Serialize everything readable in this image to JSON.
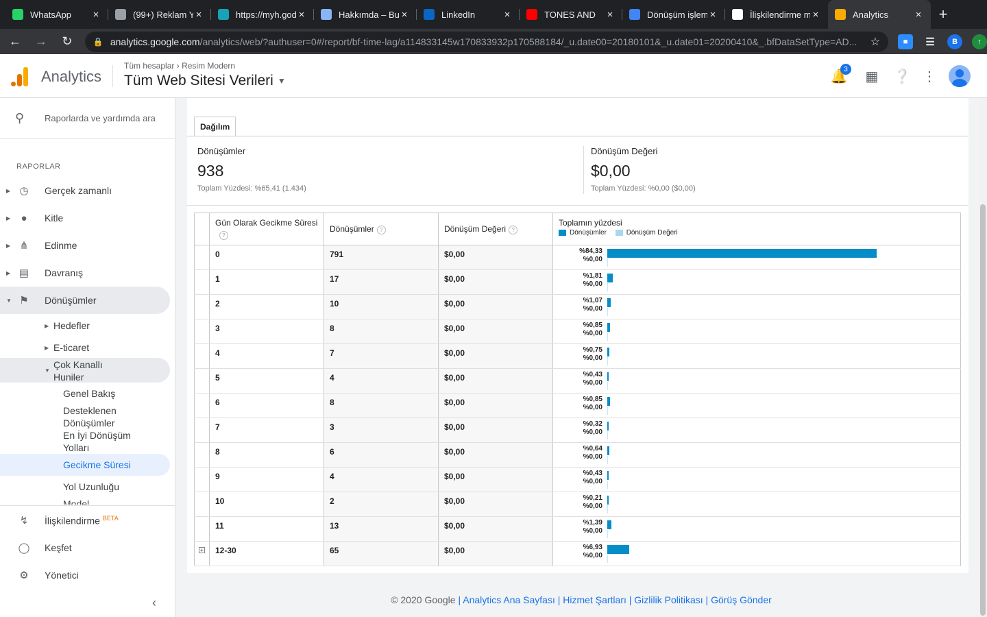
{
  "browser": {
    "tabs": [
      {
        "title": "WhatsApp",
        "favicon": "whatsapp-icon",
        "color": "#25d366"
      },
      {
        "title": "(99+) Reklam Y",
        "favicon": "image-icon",
        "color": "#9aa0a6"
      },
      {
        "title": "https://myh.god",
        "favicon": "swirl-icon",
        "color": "#17a2b8"
      },
      {
        "title": "Hakkımda – Bur",
        "favicon": "page-icon",
        "color": "#8ab4f8"
      },
      {
        "title": "LinkedIn",
        "favicon": "linkedin-icon",
        "color": "#0a66c2"
      },
      {
        "title": "TONES AND",
        "favicon": "youtube-icon",
        "color": "#ff0000"
      },
      {
        "title": "Dönüşüm işlem",
        "favicon": "google-ads-icon",
        "color": "#4285f4"
      },
      {
        "title": "İlişkilendirme m",
        "favicon": "google-icon",
        "color": "#ffffff"
      },
      {
        "title": "Analytics",
        "favicon": "analytics-icon",
        "color": "#f9ab00"
      }
    ],
    "url_host": "analytics.google.com",
    "url_path": "/analytics/web/?authuser=0#/report/bf-time-lag/a114833145w170833932p170588184/_u.date00=20180101&_u.date01=20200410&_.bfDataSetType=AD...",
    "profile_initial": "B"
  },
  "header": {
    "app_name": "Analytics",
    "breadcrumb_all": "Tüm hesaplar",
    "breadcrumb_account": "Resim Modern",
    "property": "Tüm Web Sitesi Verileri",
    "notification_count": "3"
  },
  "sidebar": {
    "search_placeholder": "Raporlarda ve yardımda ara",
    "section_title": "RAPORLAR",
    "items": [
      {
        "label": "Gerçek zamanlı",
        "icon": "clock-icon"
      },
      {
        "label": "Kitle",
        "icon": "person-icon"
      },
      {
        "label": "Edinme",
        "icon": "acquisition-icon"
      },
      {
        "label": "Davranış",
        "icon": "behavior-icon"
      },
      {
        "label": "Dönüşümler",
        "icon": "flag-icon"
      }
    ],
    "sub_items": [
      "Hedefler",
      "E-ticaret",
      "Çok Kanallı Huniler"
    ],
    "funnel_items": [
      "Genel Bakış",
      "Desteklenen Dönüşümler",
      "En İyi Dönüşüm Yolları",
      "Gecikme Süresi",
      "Yol Uzunluğu",
      "Model"
    ],
    "bottom_items": [
      {
        "label": "İlişkilendirme",
        "icon": "attribution-icon",
        "badge": "BETA"
      },
      {
        "label": "Keşfet",
        "icon": "lightbulb-icon"
      },
      {
        "label": "Yönetici",
        "icon": "gear-icon"
      }
    ]
  },
  "report": {
    "tab_label": "Dağılım",
    "summary": [
      {
        "title": "Dönüşümler",
        "value": "938",
        "sub": "Toplam Yüzdesi: %65,41 (1.434)"
      },
      {
        "title": "Dönüşüm Değeri",
        "value": "$0,00",
        "sub": "Toplam Yüzdesi: %0,00 ($0,00)"
      }
    ],
    "columns": {
      "delay": "Gün Olarak Gecikme Süresi",
      "conversions": "Dönüşümler",
      "value": "Dönüşüm Değeri",
      "percent": "Toplamın yüzdesi",
      "legend_conversions": "Dönüşümler",
      "legend_value": "Dönüşüm Değeri"
    },
    "colors": {
      "conversions": "#058dc7",
      "value": "#a8d7f0"
    },
    "rows": [
      {
        "days": "0",
        "conversions": "791",
        "value": "$0,00",
        "pct_conv": "%84,33",
        "pct_val": "%0,00",
        "share": 84.33
      },
      {
        "days": "1",
        "conversions": "17",
        "value": "$0,00",
        "pct_conv": "%1,81",
        "pct_val": "%0,00",
        "share": 1.81
      },
      {
        "days": "2",
        "conversions": "10",
        "value": "$0,00",
        "pct_conv": "%1,07",
        "pct_val": "%0,00",
        "share": 1.07
      },
      {
        "days": "3",
        "conversions": "8",
        "value": "$0,00",
        "pct_conv": "%0,85",
        "pct_val": "%0,00",
        "share": 0.85
      },
      {
        "days": "4",
        "conversions": "7",
        "value": "$0,00",
        "pct_conv": "%0,75",
        "pct_val": "%0,00",
        "share": 0.75
      },
      {
        "days": "5",
        "conversions": "4",
        "value": "$0,00",
        "pct_conv": "%0,43",
        "pct_val": "%0,00",
        "share": 0.43
      },
      {
        "days": "6",
        "conversions": "8",
        "value": "$0,00",
        "pct_conv": "%0,85",
        "pct_val": "%0,00",
        "share": 0.85
      },
      {
        "days": "7",
        "conversions": "3",
        "value": "$0,00",
        "pct_conv": "%0,32",
        "pct_val": "%0,00",
        "share": 0.32
      },
      {
        "days": "8",
        "conversions": "6",
        "value": "$0,00",
        "pct_conv": "%0,64",
        "pct_val": "%0,00",
        "share": 0.64
      },
      {
        "days": "9",
        "conversions": "4",
        "value": "$0,00",
        "pct_conv": "%0,43",
        "pct_val": "%0,00",
        "share": 0.43
      },
      {
        "days": "10",
        "conversions": "2",
        "value": "$0,00",
        "pct_conv": "%0,21",
        "pct_val": "%0,00",
        "share": 0.21
      },
      {
        "days": "11",
        "conversions": "13",
        "value": "$0,00",
        "pct_conv": "%1,39",
        "pct_val": "%0,00",
        "share": 1.39
      },
      {
        "days": "12-30",
        "conversions": "65",
        "value": "$0,00",
        "pct_conv": "%6,93",
        "pct_val": "%0,00",
        "share": 6.93
      }
    ]
  },
  "footer": {
    "copyright": "© 2020 Google",
    "links": [
      "Analytics Ana Sayfası",
      "Hizmet Şartları",
      "Gizlilik Politikası",
      "Görüş Gönder"
    ]
  }
}
